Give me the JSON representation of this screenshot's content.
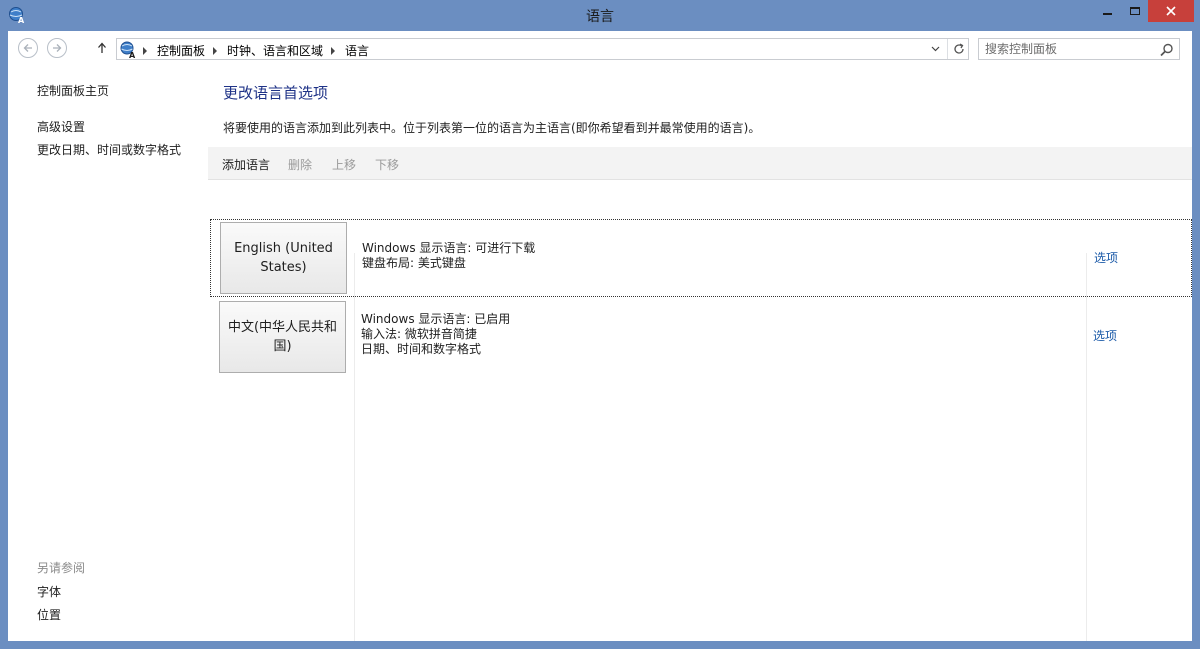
{
  "window": {
    "title": "语言"
  },
  "address": {
    "crumbs": [
      "控制面板",
      "时钟、语言和区域",
      "语言"
    ]
  },
  "search": {
    "placeholder": "搜索控制面板"
  },
  "sidebar": {
    "home": "控制面板主页",
    "links": [
      "高级设置",
      "更改日期、时间或数字格式"
    ],
    "see_also_title": "另请参阅",
    "see_also": [
      "字体",
      "位置"
    ]
  },
  "main": {
    "heading": "更改语言首选项",
    "description": "将要使用的语言添加到此列表中。位于列表第一位的语言为主语言(即你希望看到并最常使用的语言)。",
    "toolbar": {
      "add": "添加语言",
      "remove": "删除",
      "move_up": "上移",
      "move_down": "下移"
    },
    "languages": [
      {
        "name": "English (United States)",
        "details": [
          "Windows 显示语言: 可进行下载",
          "键盘布局: 美式键盘"
        ],
        "options": "选项"
      },
      {
        "name": "中文(中华人民共和国)",
        "details": [
          "Windows 显示语言: 已启用",
          "输入法: 微软拼音简捷",
          "日期、时间和数字格式"
        ],
        "options": "选项"
      }
    ]
  },
  "colors": {
    "frame": "#6b8ec1",
    "close_button": "#c7403b",
    "heading": "#1e3287",
    "link": "#1b5aa8",
    "disabled_text": "#9a9a9a"
  }
}
